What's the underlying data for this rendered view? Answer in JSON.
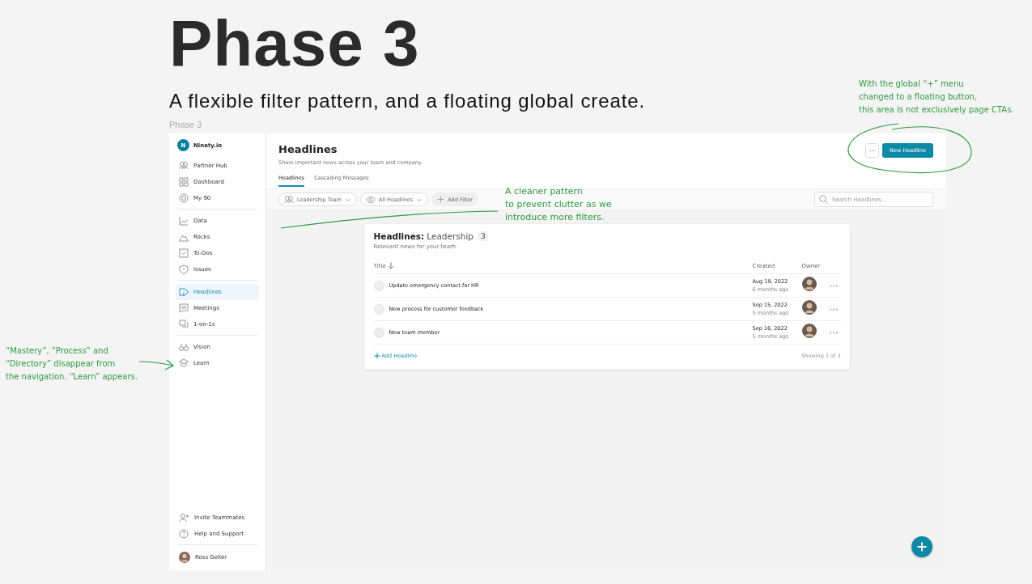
{
  "heading": "Phase 3",
  "subheading": "A flexible filter pattern, and a floating global create.",
  "frame_label": "Phase 3",
  "sidebar": {
    "org": {
      "initial": "N",
      "name": "Ninety.io"
    },
    "sections": [
      {
        "items": [
          {
            "label": "Partner Hub",
            "selected": false
          },
          {
            "label": "Dashboard",
            "selected": false
          },
          {
            "label": "My 90",
            "selected": false
          }
        ]
      },
      {
        "items": [
          {
            "label": "Data",
            "selected": false
          },
          {
            "label": "Rocks",
            "selected": false
          },
          {
            "label": "To-Dos",
            "selected": false
          },
          {
            "label": "Issues",
            "selected": false
          }
        ]
      },
      {
        "items": [
          {
            "label": "Headlines",
            "selected": true
          },
          {
            "label": "Meetings",
            "selected": false
          },
          {
            "label": "1-on-1s",
            "selected": false
          }
        ]
      },
      {
        "items": [
          {
            "label": "Vision",
            "selected": false
          },
          {
            "label": "Learn",
            "selected": false
          }
        ]
      }
    ],
    "bottom_items": [
      {
        "label": "Invite Teammates"
      },
      {
        "label": "Help and Support"
      }
    ],
    "user": {
      "name": "Ross Geller"
    }
  },
  "page": {
    "title": "Headlines",
    "subtitle": "Share important news across your team and company.",
    "more_button": "···",
    "create_button": "New Headline",
    "tabs": [
      {
        "label": "Headlines",
        "selected": true
      },
      {
        "label": "Cascading Messages",
        "selected": false
      }
    ],
    "filters": [
      {
        "kind": "dropdown",
        "label": "Leadership Team"
      },
      {
        "kind": "dropdown",
        "label": "All Headlines"
      },
      {
        "kind": "add",
        "label": "Add Filter"
      }
    ],
    "search": {
      "placeholder": "Search Headlines..."
    }
  },
  "card": {
    "title": "Headlines:",
    "team": "Leadership",
    "count": "3",
    "subtitle": "Relevant news for your team.",
    "columns": [
      "Title",
      "Created",
      "Owner"
    ],
    "rows": [
      {
        "title": "Update emergency contact for HR",
        "date": "Aug 19, 2022",
        "ago": "6 months ago",
        "checked": false
      },
      {
        "title": "New process for customer feedback",
        "date": "Sep 15, 2022",
        "ago": "5 months ago",
        "checked": false
      },
      {
        "title": "New team member",
        "date": "Sep 16, 2022",
        "ago": "5 months ago",
        "checked": false
      }
    ],
    "add_label": "Add Headline",
    "showing": "Showing 3 of 3"
  },
  "annotations": [
    {
      "kind": "top",
      "text": "With the global “+” menu\nchanged to a floating button,\nthis area is not exclusively page CTAs."
    },
    {
      "kind": "middle",
      "text": "A cleaner pattern\nto prevent clutter as we\nintroduce more filters."
    },
    {
      "kind": "left",
      "text": "“Mastery”, “Process” and\n“Directory” disappear from\nthe navigation. “Learn” appears."
    }
  ]
}
